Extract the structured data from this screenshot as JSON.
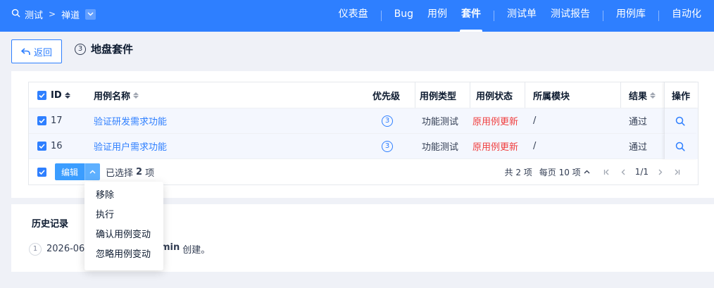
{
  "breadcrumb": {
    "product": "测试",
    "sep": ">",
    "project": "禅道"
  },
  "nav": {
    "items": [
      "仪表盘",
      "Bug",
      "用例",
      "套件",
      "测试单",
      "测试报告",
      "用例库",
      "自动化"
    ],
    "active": 3
  },
  "subheader": {
    "back_label": "返回",
    "suite_priority": "3",
    "suite_name": "地盘套件"
  },
  "table": {
    "columns": {
      "id": "ID",
      "title": "用例名称",
      "pri": "优先级",
      "type": "用例类型",
      "status": "用例状态",
      "module": "所属模块",
      "result": "结果",
      "actions": "操作"
    },
    "rows": [
      {
        "id": "17",
        "title": "验证研发需求功能",
        "pri": "3",
        "type": "功能测试",
        "status": "原用例更新",
        "module": "/",
        "result": "通过"
      },
      {
        "id": "16",
        "title": "验证用户需求功能",
        "pri": "3",
        "type": "功能测试",
        "status": "原用例更新",
        "module": "/",
        "result": "通过"
      }
    ],
    "footer": {
      "edit_label": "编辑",
      "selected_prefix": "已选择",
      "selected_count": "2",
      "selected_suffix": "项",
      "total": "共 2 项",
      "per_page": "每页 10 项",
      "page": "1/1"
    }
  },
  "dropdown": {
    "items": [
      "移除",
      "执行",
      "确认用例变动",
      "忽略用例变动"
    ]
  },
  "history": {
    "title": "历史记录",
    "entries": [
      {
        "num": "1",
        "date": "2026-06-",
        "user": "min",
        "action": "创建。"
      }
    ]
  },
  "colors": {
    "primary": "#2e7fff",
    "danger": "#f03e3e",
    "bg": "#eff1f7"
  }
}
